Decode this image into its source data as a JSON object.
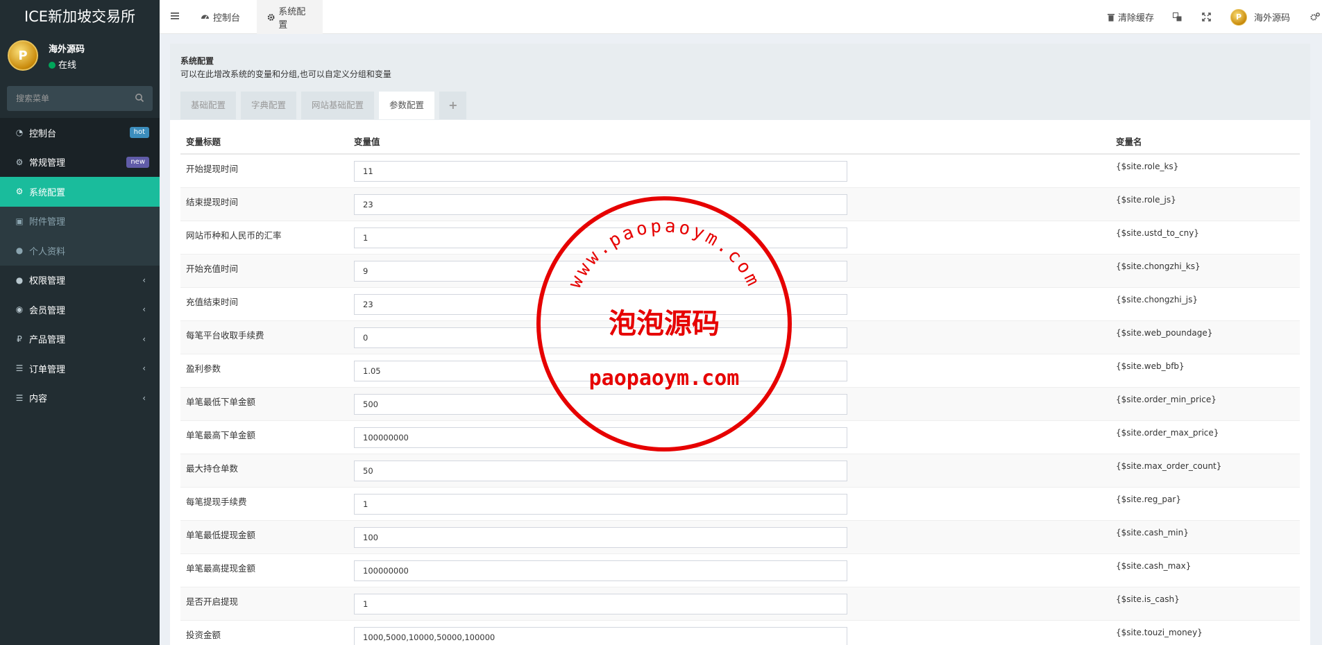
{
  "app": {
    "title": "ICE新加坡交易所"
  },
  "user": {
    "name": "海外源码",
    "status": "在线",
    "avatar_letter": "P"
  },
  "search": {
    "placeholder": "搜索菜单"
  },
  "menu": [
    {
      "label": "控制台",
      "icon": "dashboard-icon",
      "badge": "hot"
    },
    {
      "label": "常规管理",
      "icon": "cogs-icon",
      "badge": "new"
    },
    {
      "label": "系统配置",
      "icon": "gear-icon"
    },
    {
      "label": "附件管理",
      "icon": "image-icon"
    },
    {
      "label": "个人资料",
      "icon": "user-icon"
    },
    {
      "label": "权限管理",
      "icon": "group-icon"
    },
    {
      "label": "会员管理",
      "icon": "user-circle-icon"
    },
    {
      "label": "产品管理",
      "icon": "ruble-icon"
    },
    {
      "label": "订单管理",
      "icon": "list-icon"
    },
    {
      "label": "内容",
      "icon": "list-icon"
    }
  ],
  "header": {
    "tabs": [
      {
        "label": "控制台",
        "icon": "dashboard-icon"
      },
      {
        "label": "系统配置",
        "icon": "gear-icon"
      }
    ],
    "clear_cache": "清除缓存",
    "user_name": "海外源码"
  },
  "panel": {
    "title": "系统配置",
    "desc": "可以在此增改系统的变量和分组,也可以自定义分组和变量",
    "tabs": [
      "基础配置",
      "字典配置",
      "网站基础配置",
      "参数配置"
    ],
    "add_tab": "+"
  },
  "table": {
    "headers": [
      "变量标题",
      "变量值",
      "变量名"
    ],
    "rows": [
      {
        "title": "开始提现时间",
        "value": "11",
        "key": "{$site.role_ks}"
      },
      {
        "title": "结束提现时间",
        "value": "23",
        "key": "{$site.role_js}"
      },
      {
        "title": "网站币种和人民币的汇率",
        "value": "1",
        "key": "{$site.ustd_to_cny}"
      },
      {
        "title": "开始充值时间",
        "value": "9",
        "key": "{$site.chongzhi_ks}"
      },
      {
        "title": "充值结束时间",
        "value": "23",
        "key": "{$site.chongzhi_js}"
      },
      {
        "title": "每笔平台收取手续费",
        "value": "0",
        "key": "{$site.web_poundage}"
      },
      {
        "title": "盈利参数",
        "value": "1.05",
        "key": "{$site.web_bfb}"
      },
      {
        "title": "单笔最低下单金额",
        "value": "500",
        "key": "{$site.order_min_price}"
      },
      {
        "title": "单笔最高下单金额",
        "value": "100000000",
        "key": "{$site.order_max_price}"
      },
      {
        "title": "最大持仓单数",
        "value": "50",
        "key": "{$site.max_order_count}"
      },
      {
        "title": "每笔提现手续费",
        "value": "1",
        "key": "{$site.reg_par}"
      },
      {
        "title": "单笔最低提现金额",
        "value": "100",
        "key": "{$site.cash_min}"
      },
      {
        "title": "单笔最高提现金额",
        "value": "100000000",
        "key": "{$site.cash_max}"
      },
      {
        "title": "是否开启提现",
        "value": "1",
        "key": "{$site.is_cash}"
      },
      {
        "title": "投资金额",
        "value": "1000,5000,10000,50000,100000",
        "key": "{$site.touzi_money}"
      }
    ]
  },
  "watermark": {
    "arc_text": "www.paopaoym.com",
    "center_text": "泡泡源码",
    "bottom_text": "paopaoym.com",
    "color": "#e60000"
  },
  "colors": {
    "sidebar": "#222d32",
    "active": "#1abc9c"
  }
}
